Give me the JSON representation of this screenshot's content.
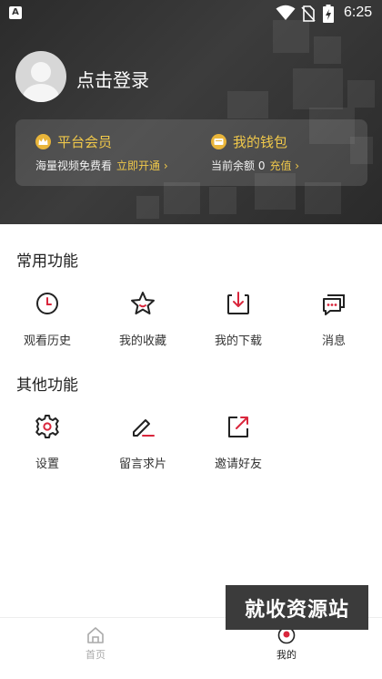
{
  "status_bar": {
    "time": "6:25",
    "app_icon": "a-letter-icon",
    "app_icon_glyph": "A",
    "wifi_icon": "wifi-icon",
    "sim_icon": "no-sim-icon",
    "battery_icon": "battery-charging-icon"
  },
  "profile": {
    "avatar_icon": "default-avatar-icon",
    "login_label": "点击登录"
  },
  "member_card": {
    "vip": {
      "icon": "crown-icon",
      "title": "平台会员",
      "desc": "海量视频免费看",
      "action": "立即开通 ›"
    },
    "wallet": {
      "icon": "wallet-icon",
      "title": "我的钱包",
      "desc": "当前余额 0",
      "action": "充值 ›"
    },
    "accent_color": "#f0c84a"
  },
  "common_functions": {
    "title": "常用功能",
    "items": [
      {
        "label": "观看历史",
        "icon": "clock-icon"
      },
      {
        "label": "我的收藏",
        "icon": "star-icon"
      },
      {
        "label": "我的下载",
        "icon": "download-icon"
      },
      {
        "label": "消息",
        "icon": "message-icon"
      }
    ]
  },
  "other_functions": {
    "title": "其他功能",
    "items": [
      {
        "label": "设置",
        "icon": "gear-icon"
      },
      {
        "label": "留言求片",
        "icon": "edit-icon"
      },
      {
        "label": "邀请好友",
        "icon": "share-icon"
      }
    ]
  },
  "bottom_nav": {
    "items": [
      {
        "label": "首页",
        "icon": "home-icon",
        "active": false
      },
      {
        "label": "我的",
        "icon": "profile-icon",
        "active": true
      }
    ]
  },
  "watermark": {
    "text": "就收资源站"
  },
  "colors": {
    "red_accent": "#d9263c",
    "gold": "#f0c84a",
    "header_dark": "#2f2f2f"
  }
}
